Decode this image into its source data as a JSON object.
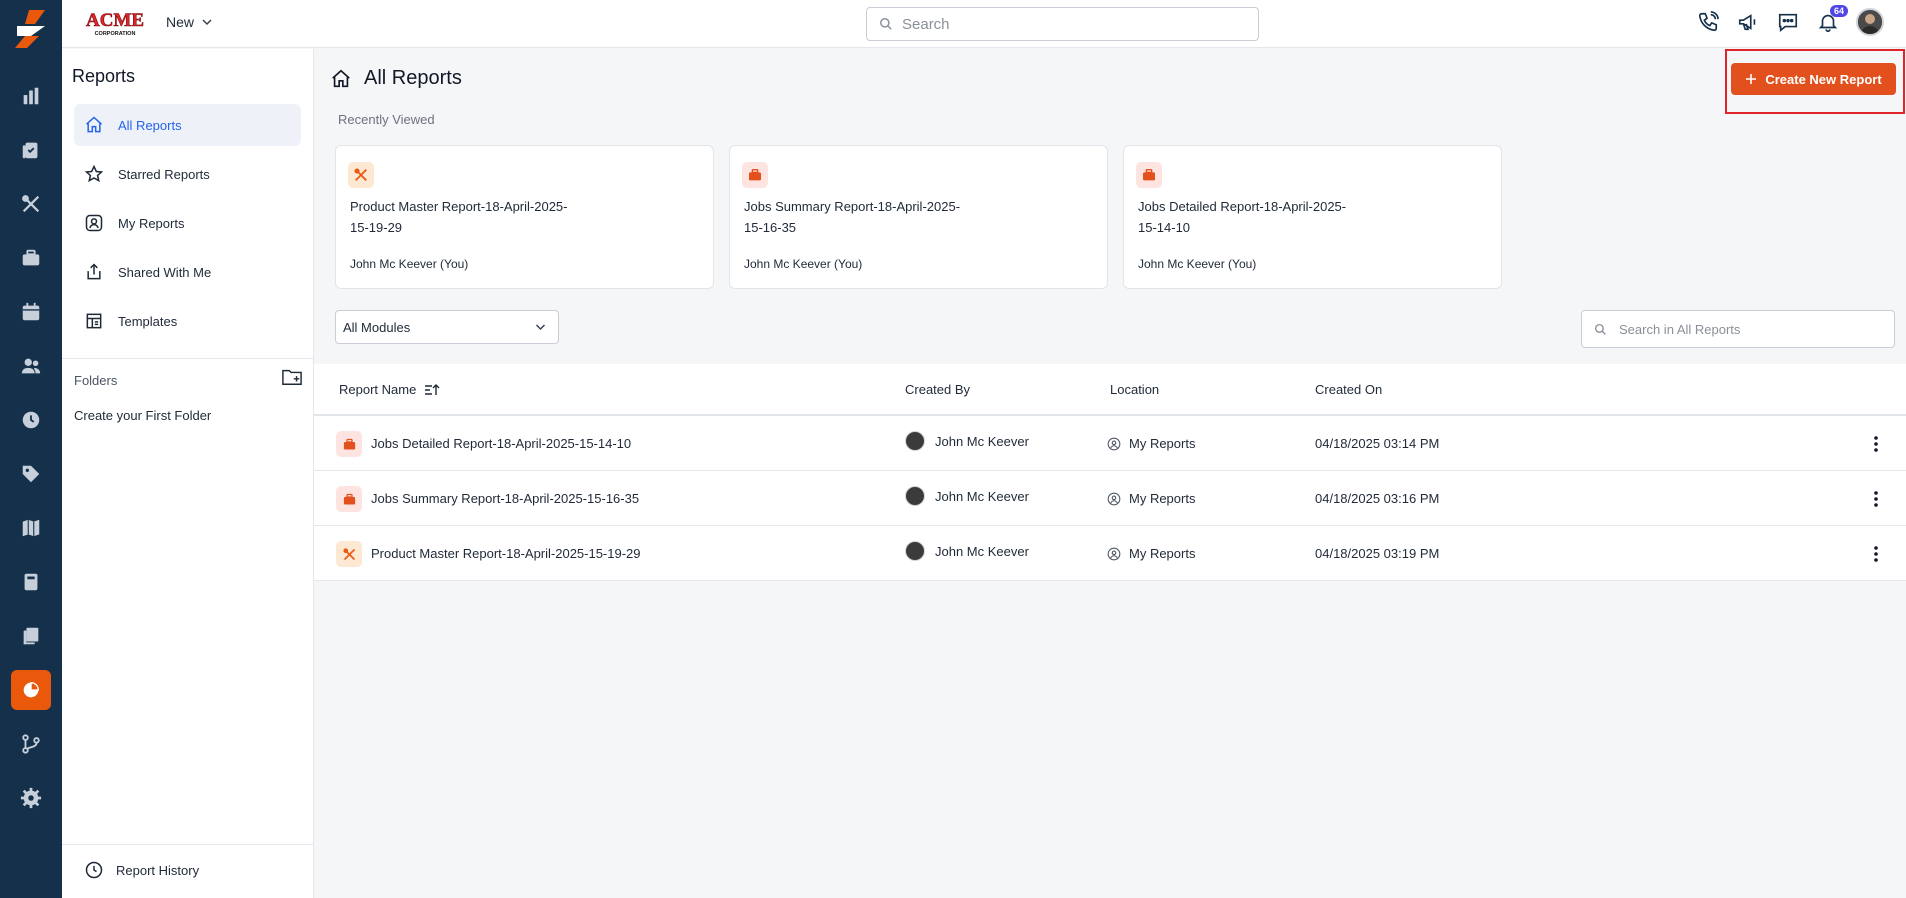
{
  "brand": {
    "logo_text": "ACME",
    "logo_subtext": "CORPORATION"
  },
  "topbar": {
    "new_label": "New",
    "search_placeholder": "Search",
    "notification_count": "64"
  },
  "rail_icons": [
    "dashboard-icon",
    "jobs-icon",
    "tools-icon",
    "briefcase-icon",
    "calendar-icon",
    "users-icon",
    "clock-icon",
    "tag-icon",
    "map-icon",
    "calculator-icon",
    "documents-icon",
    "reports-icon",
    "workflow-icon",
    "settings-icon"
  ],
  "sidebar": {
    "title": "Reports",
    "items": [
      {
        "label": "All Reports",
        "icon": "home-icon"
      },
      {
        "label": "Starred Reports",
        "icon": "star-icon"
      },
      {
        "label": "My Reports",
        "icon": "user-icon"
      },
      {
        "label": "Shared With Me",
        "icon": "share-icon"
      },
      {
        "label": "Templates",
        "icon": "template-icon"
      }
    ],
    "folders_label": "Folders",
    "create_folder_text": "Create your First Folder",
    "report_history_label": "Report History"
  },
  "main": {
    "title": "All Reports",
    "create_button": "Create New Report",
    "recently_viewed_label": "Recently Viewed",
    "recent_cards": [
      {
        "title": "Product Master Report-18-April-2025-15-19-29",
        "created_by": "John Mc Keever  (You)",
        "icon": "tools-icon"
      },
      {
        "title": "Jobs Summary Report-18-April-2025-15-16-35",
        "created_by": "John Mc Keever  (You)",
        "icon": "briefcase-icon"
      },
      {
        "title": "Jobs Detailed Report-18-April-2025-15-14-10",
        "created_by": "John Mc Keever  (You)",
        "icon": "briefcase-icon"
      }
    ],
    "modules_filter": "All Modules",
    "search_placeholder": "Search in All Reports",
    "table": {
      "columns": [
        "Report Name",
        "Created By",
        "Location",
        "Created On"
      ],
      "rows": [
        {
          "name": "Jobs Detailed Report-18-April-2025-15-14-10",
          "created_by": "John Mc Keever",
          "location": "My Reports",
          "created_on": "04/18/2025 03:14 PM",
          "icon": "briefcase-icon"
        },
        {
          "name": "Jobs Summary Report-18-April-2025-15-16-35",
          "created_by": "John Mc Keever",
          "location": "My Reports",
          "created_on": "04/18/2025 03:16 PM",
          "icon": "briefcase-icon"
        },
        {
          "name": "Product Master Report-18-April-2025-15-19-29",
          "created_by": "John Mc Keever",
          "location": "My Reports",
          "created_on": "04/18/2025 03:19 PM",
          "icon": "tools-icon"
        }
      ]
    }
  },
  "colors": {
    "rail": "#14304a",
    "accent": "#e2501e",
    "active_nav": "#2563eb",
    "highlight_border": "#e0242a"
  }
}
